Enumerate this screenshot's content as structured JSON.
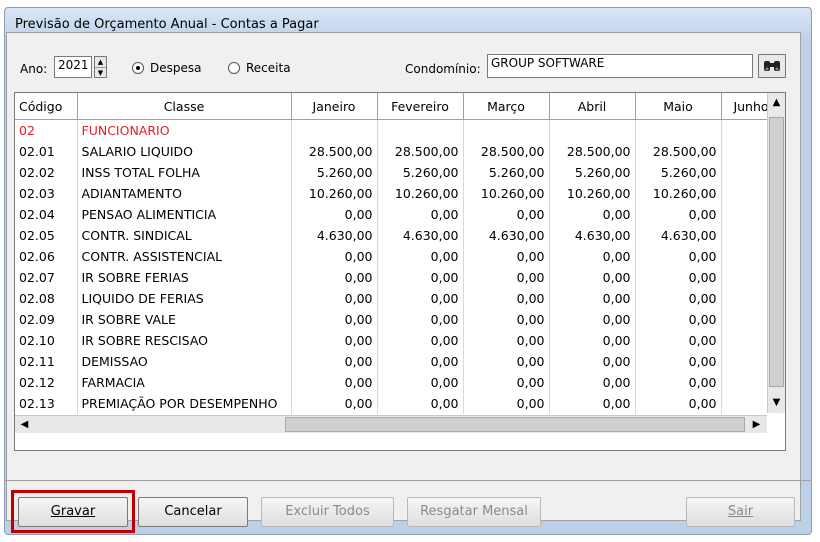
{
  "window": {
    "title": "Previsão de Orçamento Anual - Contas a Pagar"
  },
  "filters": {
    "ano_label": "Ano:",
    "ano_value": "2021",
    "radio_despesa": "Despesa",
    "radio_receita": "Receita",
    "selected": "Despesa",
    "condominio_label": "Condomínio:",
    "condominio_value": "GROUP SOFTWARE",
    "search_icon": "binoculars-icon"
  },
  "table": {
    "columns": [
      "Código",
      "Classe",
      "Janeiro",
      "Fevereiro",
      "Março",
      "Abril",
      "Maio",
      "Junho"
    ],
    "rows": [
      {
        "codigo": "02",
        "classe": "FUNCIONARIO",
        "values": [
          "",
          "",
          "",
          "",
          ""
        ],
        "group": true
      },
      {
        "codigo": "02.01",
        "classe": "SALARIO LIQUIDO",
        "values": [
          "28.500,00",
          "28.500,00",
          "28.500,00",
          "28.500,00",
          "28.500,00"
        ]
      },
      {
        "codigo": "02.02",
        "classe": "INSS TOTAL FOLHA",
        "values": [
          "5.260,00",
          "5.260,00",
          "5.260,00",
          "5.260,00",
          "5.260,00"
        ]
      },
      {
        "codigo": "02.03",
        "classe": "ADIANTAMENTO",
        "values": [
          "10.260,00",
          "10.260,00",
          "10.260,00",
          "10.260,00",
          "10.260,00"
        ]
      },
      {
        "codigo": "02.04",
        "classe": "PENSAO ALIMENTICIA",
        "values": [
          "0,00",
          "0,00",
          "0,00",
          "0,00",
          "0,00"
        ]
      },
      {
        "codigo": "02.05",
        "classe": "CONTR. SINDICAL",
        "values": [
          "4.630,00",
          "4.630,00",
          "4.630,00",
          "4.630,00",
          "4.630,00"
        ]
      },
      {
        "codigo": "02.06",
        "classe": "CONTR. ASSISTENCIAL",
        "values": [
          "0,00",
          "0,00",
          "0,00",
          "0,00",
          "0,00"
        ]
      },
      {
        "codigo": "02.07",
        "classe": "IR SOBRE FERIAS",
        "values": [
          "0,00",
          "0,00",
          "0,00",
          "0,00",
          "0,00"
        ]
      },
      {
        "codigo": "02.08",
        "classe": "LIQUIDO DE FERIAS",
        "values": [
          "0,00",
          "0,00",
          "0,00",
          "0,00",
          "0,00"
        ]
      },
      {
        "codigo": "02.09",
        "classe": "IR SOBRE VALE",
        "values": [
          "0,00",
          "0,00",
          "0,00",
          "0,00",
          "0,00"
        ]
      },
      {
        "codigo": "02.10",
        "classe": "IR SOBRE RESCISAO",
        "values": [
          "0,00",
          "0,00",
          "0,00",
          "0,00",
          "0,00"
        ]
      },
      {
        "codigo": "02.11",
        "classe": "DEMISSAO",
        "values": [
          "0,00",
          "0,00",
          "0,00",
          "0,00",
          "0,00"
        ]
      },
      {
        "codigo": "02.12",
        "classe": "FARMACIA",
        "values": [
          "0,00",
          "0,00",
          "0,00",
          "0,00",
          "0,00"
        ]
      },
      {
        "codigo": "02.13",
        "classe": "PREMIAÇÃO POR DESEMPENHO",
        "values": [
          "0,00",
          "0,00",
          "0,00",
          "0,00",
          "0,00"
        ]
      }
    ]
  },
  "buttons": {
    "gravar": "Gravar",
    "cancelar": "Cancelar",
    "excluir_todos": "Excluir Todos",
    "resgatar_mensal": "Resgatar Mensal",
    "sair": "Sair"
  },
  "colors": {
    "group_row": "#e0202b",
    "highlight_box": "#c00000"
  }
}
